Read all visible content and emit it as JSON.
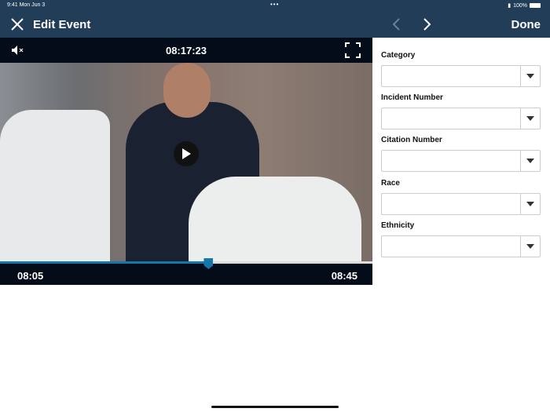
{
  "status": {
    "time": "9:41  Mon Jun 3",
    "battery": "100%"
  },
  "header": {
    "title": "Edit Event",
    "done_label": "Done"
  },
  "player": {
    "timecode": "08:17:23",
    "start_time": "08:05",
    "end_time": "08:45",
    "progress": 0.56,
    "accent": "#1577a8"
  },
  "form": {
    "fields": [
      {
        "label": "Category",
        "value": ""
      },
      {
        "label": "Incident Number",
        "value": ""
      },
      {
        "label": "Citation Number",
        "value": ""
      },
      {
        "label": "Race",
        "value": ""
      },
      {
        "label": "Ethnicity",
        "value": ""
      }
    ]
  }
}
